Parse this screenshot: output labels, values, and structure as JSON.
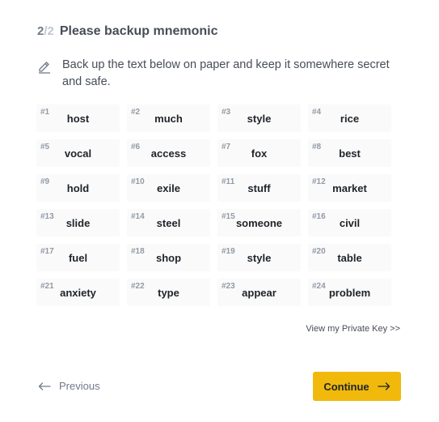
{
  "header": {
    "step_current": "2",
    "step_separator_total": "/2",
    "title": "Please backup mnemonic"
  },
  "notice": {
    "icon": "pencil-icon",
    "text": "Back up the text below on paper and keep it somewhere secret and safe."
  },
  "mnemonic": [
    {
      "num": "#1",
      "word": "host"
    },
    {
      "num": "#2",
      "word": "much"
    },
    {
      "num": "#3",
      "word": "style"
    },
    {
      "num": "#4",
      "word": "rice"
    },
    {
      "num": "#5",
      "word": "vocal"
    },
    {
      "num": "#6",
      "word": "access"
    },
    {
      "num": "#7",
      "word": "fox"
    },
    {
      "num": "#8",
      "word": "best"
    },
    {
      "num": "#9",
      "word": "hold"
    },
    {
      "num": "#10",
      "word": "exile"
    },
    {
      "num": "#11",
      "word": "stuff"
    },
    {
      "num": "#12",
      "word": "market"
    },
    {
      "num": "#13",
      "word": "slide"
    },
    {
      "num": "#14",
      "word": "steel"
    },
    {
      "num": "#15",
      "word": "someone"
    },
    {
      "num": "#16",
      "word": "civil"
    },
    {
      "num": "#17",
      "word": "fuel"
    },
    {
      "num": "#18",
      "word": "shop"
    },
    {
      "num": "#19",
      "word": "style"
    },
    {
      "num": "#20",
      "word": "table"
    },
    {
      "num": "#21",
      "word": "anxiety"
    },
    {
      "num": "#22",
      "word": "type"
    },
    {
      "num": "#23",
      "word": "appear"
    },
    {
      "num": "#24",
      "word": "problem"
    }
  ],
  "links": {
    "private_key": "View my Private Key >>"
  },
  "footer": {
    "previous_label": "Previous",
    "continue_label": "Continue"
  },
  "colors": {
    "accent": "#f0b90b",
    "cell_background": "#fafafa",
    "muted_text": "#707a8a"
  }
}
